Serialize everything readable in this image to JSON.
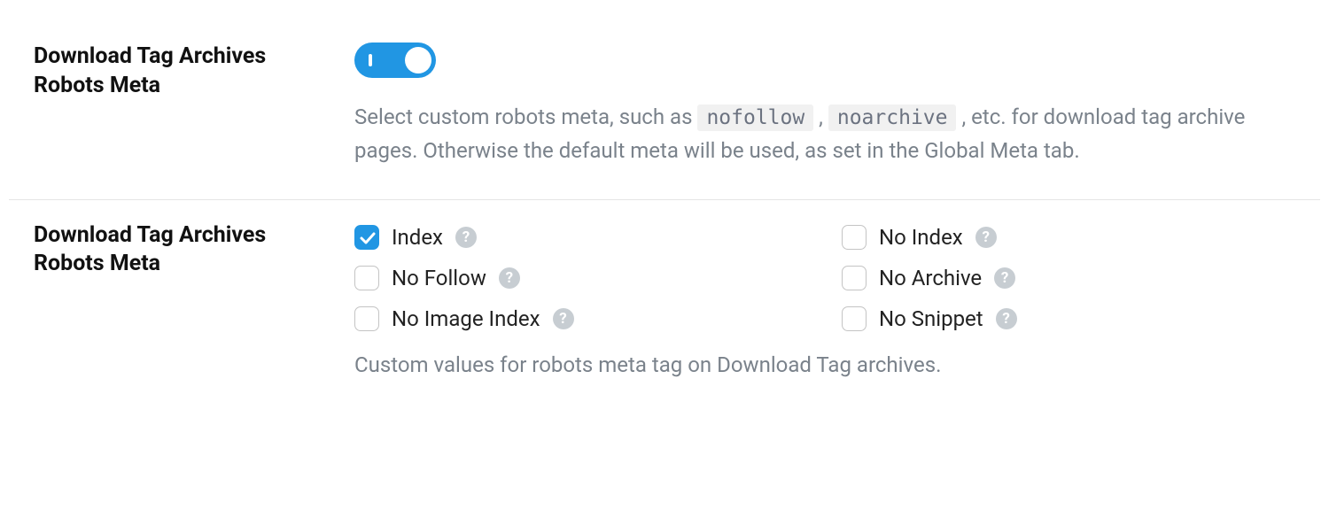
{
  "section1": {
    "title": "Download Tag Archives Robots Meta",
    "toggle_on": true,
    "desc_pre": "Select custom robots meta, such as ",
    "code1": "nofollow",
    "desc_mid": " , ",
    "code2": "noarchive",
    "desc_post": " , etc. for download tag archive pages. Otherwise the default meta will be used, as set in the Global Meta tab."
  },
  "section2": {
    "title": "Download Tag Archives Robots Meta",
    "options_left": [
      {
        "label": "Index",
        "checked": true
      },
      {
        "label": "No Follow",
        "checked": false
      },
      {
        "label": "No Image Index",
        "checked": false
      }
    ],
    "options_right": [
      {
        "label": "No Index",
        "checked": false
      },
      {
        "label": "No Archive",
        "checked": false
      },
      {
        "label": "No Snippet",
        "checked": false
      }
    ],
    "desc": "Custom values for robots meta tag on Download Tag archives."
  },
  "help_glyph": "?"
}
